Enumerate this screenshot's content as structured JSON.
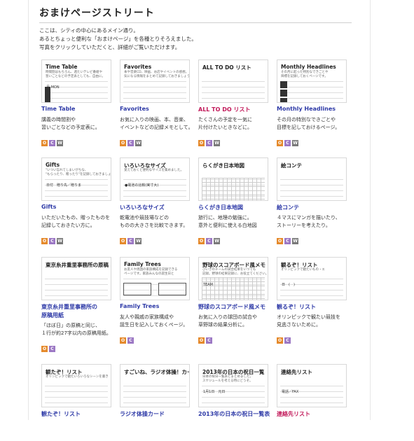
{
  "page": {
    "title": "おまけページストリート",
    "intro": [
      "ここは、シティの中心にあるメイン通り。",
      "あるとちょっと便利な「おまけページ」を各種とりそろえました。",
      "写真をクリックしていただくと、詳細がご覧いただけます。"
    ]
  },
  "badge_letters": {
    "o": "O",
    "c": "C",
    "w": "W"
  },
  "cards": [
    {
      "name": "Time Table",
      "thumb_title": "Time Table",
      "thumb_sub": [
        "時間割はもちろん、週たいテレビ番組や",
        "習いごとなどの予定表としても、自由に。"
      ],
      "thumb_extra": "月 MON",
      "desc": [
        "講義の時間割や",
        "習いごとなどの予定表に。"
      ],
      "badges": [
        "o",
        "c",
        "w"
      ]
    },
    {
      "name": "Favorites",
      "thumb_title": "Favorites",
      "thumb_sub": [
        "本や音楽CD、映画、お店やイベントの感想。",
        "気になる情報をまとめて記録しておきましょう。"
      ],
      "desc": [
        "お気に入りの映画、本、音楽、",
        "イベントなどの記録メモとして。"
      ],
      "badges": [
        "o",
        "c",
        "w"
      ]
    },
    {
      "name": "ALL TO DO リスト",
      "thumb_title": "ALL TO DO リスト",
      "desc": [
        "たくさんの予定を一気に",
        "片付けたいときなどに。"
      ],
      "badges": [
        "o",
        "c",
        "w"
      ]
    },
    {
      "name": "Monthly Headlines",
      "thumb_title": "Monthly Headlines",
      "thumb_sub": [
        "その月に起った特別なできごとや",
        "目標を記録しておくページです。"
      ],
      "desc": [
        "その月の特別なできごとや",
        "目標を記しておけるページ。"
      ],
      "badges": [
        "o",
        "c",
        "w"
      ]
    },
    {
      "name": "Gifts",
      "thumb_title": "Gifts",
      "thumb_sub": [
        "\"いつい忘れてしまいがちな、",
        "\"もらったり、贈ったり\"を記録しておきましょう。"
      ],
      "thumb_extra": "日付　贈り先／贈りま",
      "desc": [
        "いただいたもの、贈ったものを",
        "記録しておきたい方に。"
      ],
      "badges": [
        "o",
        "c",
        "w"
      ]
    },
    {
      "name": "いろいろなサイズ",
      "thumb_title": "いろいろなサイズ",
      "thumb_sub": [
        "覚えておくと便利なサイズを集めました。"
      ],
      "thumb_extra": "●電池の比較(実寸大)",
      "desc": [
        "乾電池や競技場などの",
        "ものの大きさを比較できます。"
      ],
      "badges": [
        "o",
        "c",
        "w"
      ]
    },
    {
      "name": "らくがき日本地図",
      "thumb_title": "らくがき日本地図",
      "desc": [
        "旅行に、地理の勉強に。",
        "意外と便利に使える白地図"
      ],
      "badges": [
        "o",
        "c",
        "w"
      ]
    },
    {
      "name": "絵コンテ",
      "thumb_title": "絵コンテ",
      "desc": [
        "４マスにマンガを描いたり、",
        "ストーリーを考えたり。"
      ],
      "badges": [
        "o",
        "c",
        "w"
      ]
    },
    {
      "name": "東京糸井重里事務所の原稿用紙",
      "name_lines": [
        "東京糸井重里事務所の",
        "原稿用紙"
      ],
      "thumb_title": "東京糸井重里事務所の原稿",
      "desc": [
        "「ほぼ日」の原稿と同じ、",
        "１行が約27字以内の原稿用紙。"
      ],
      "badges": [
        "o",
        "c"
      ]
    },
    {
      "name": "Family Trees",
      "thumb_title": "Family Trees",
      "thumb_sub": [
        "お友人や周囲の家族構成を記録できる",
        "ページです。家族みんなの誕生日と"
      ],
      "desc": [
        "友人や親戚の家族構成や",
        "誕生日を記入しておくページ。"
      ],
      "badges": [
        "o",
        "c"
      ]
    },
    {
      "name": "野球のスコアボード風メモ",
      "thumb_title": "野球のスコアボード風メモ",
      "thumb_sub": [
        "ひいきのチームの試合結果をいつでも",
        "記録。野球の結果記録に、お役立てください。"
      ],
      "thumb_extra": "TEAM",
      "desc": [
        "お気に入りの球団の試合や",
        "草野球の結果分析に。"
      ],
      "badges": [
        "o",
        "c"
      ]
    },
    {
      "name": "観るぞ！リスト",
      "thumb_title": "観るぞ！リスト",
      "thumb_sub": [
        "オリンピックで観たいもの・エ"
      ],
      "thumb_extra": "日　(　)",
      "desc": [
        "オリンピックで観たい競技を",
        "見逃さないために。"
      ],
      "badges": [
        "o",
        "c"
      ]
    },
    {
      "name": "観たぞ！リスト",
      "thumb_title": "観たぞ！リスト",
      "thumb_sub": [
        "オリンピックで観たいろいろなシーンを書き"
      ],
      "badges": []
    },
    {
      "name": "ラジオ体操カード",
      "thumb_title": "すごいね、ラジオ体操！カード",
      "badges": []
    },
    {
      "name": "2013年の日本の祝日一覧表",
      "thumb_title": "2013年の日本の祝日一覧",
      "thumb_sub": [
        "日本の祝日一覧表とまとめました。",
        "スケジュールを考える時にどうぞ。"
      ],
      "thumb_extra": "1月1日　元日",
      "badges": []
    },
    {
      "name": "連絡先リスト",
      "name_red": true,
      "thumb_title": "連絡先リスト",
      "thumb_extra": "電話／FAX",
      "badges": []
    }
  ],
  "colors": {
    "link": "#2e3aa7",
    "link_red": "#c21a5a",
    "badge_o": "#e58a2c",
    "badge_c": "#9c78c4",
    "badge_w": "#7a7a7a"
  }
}
